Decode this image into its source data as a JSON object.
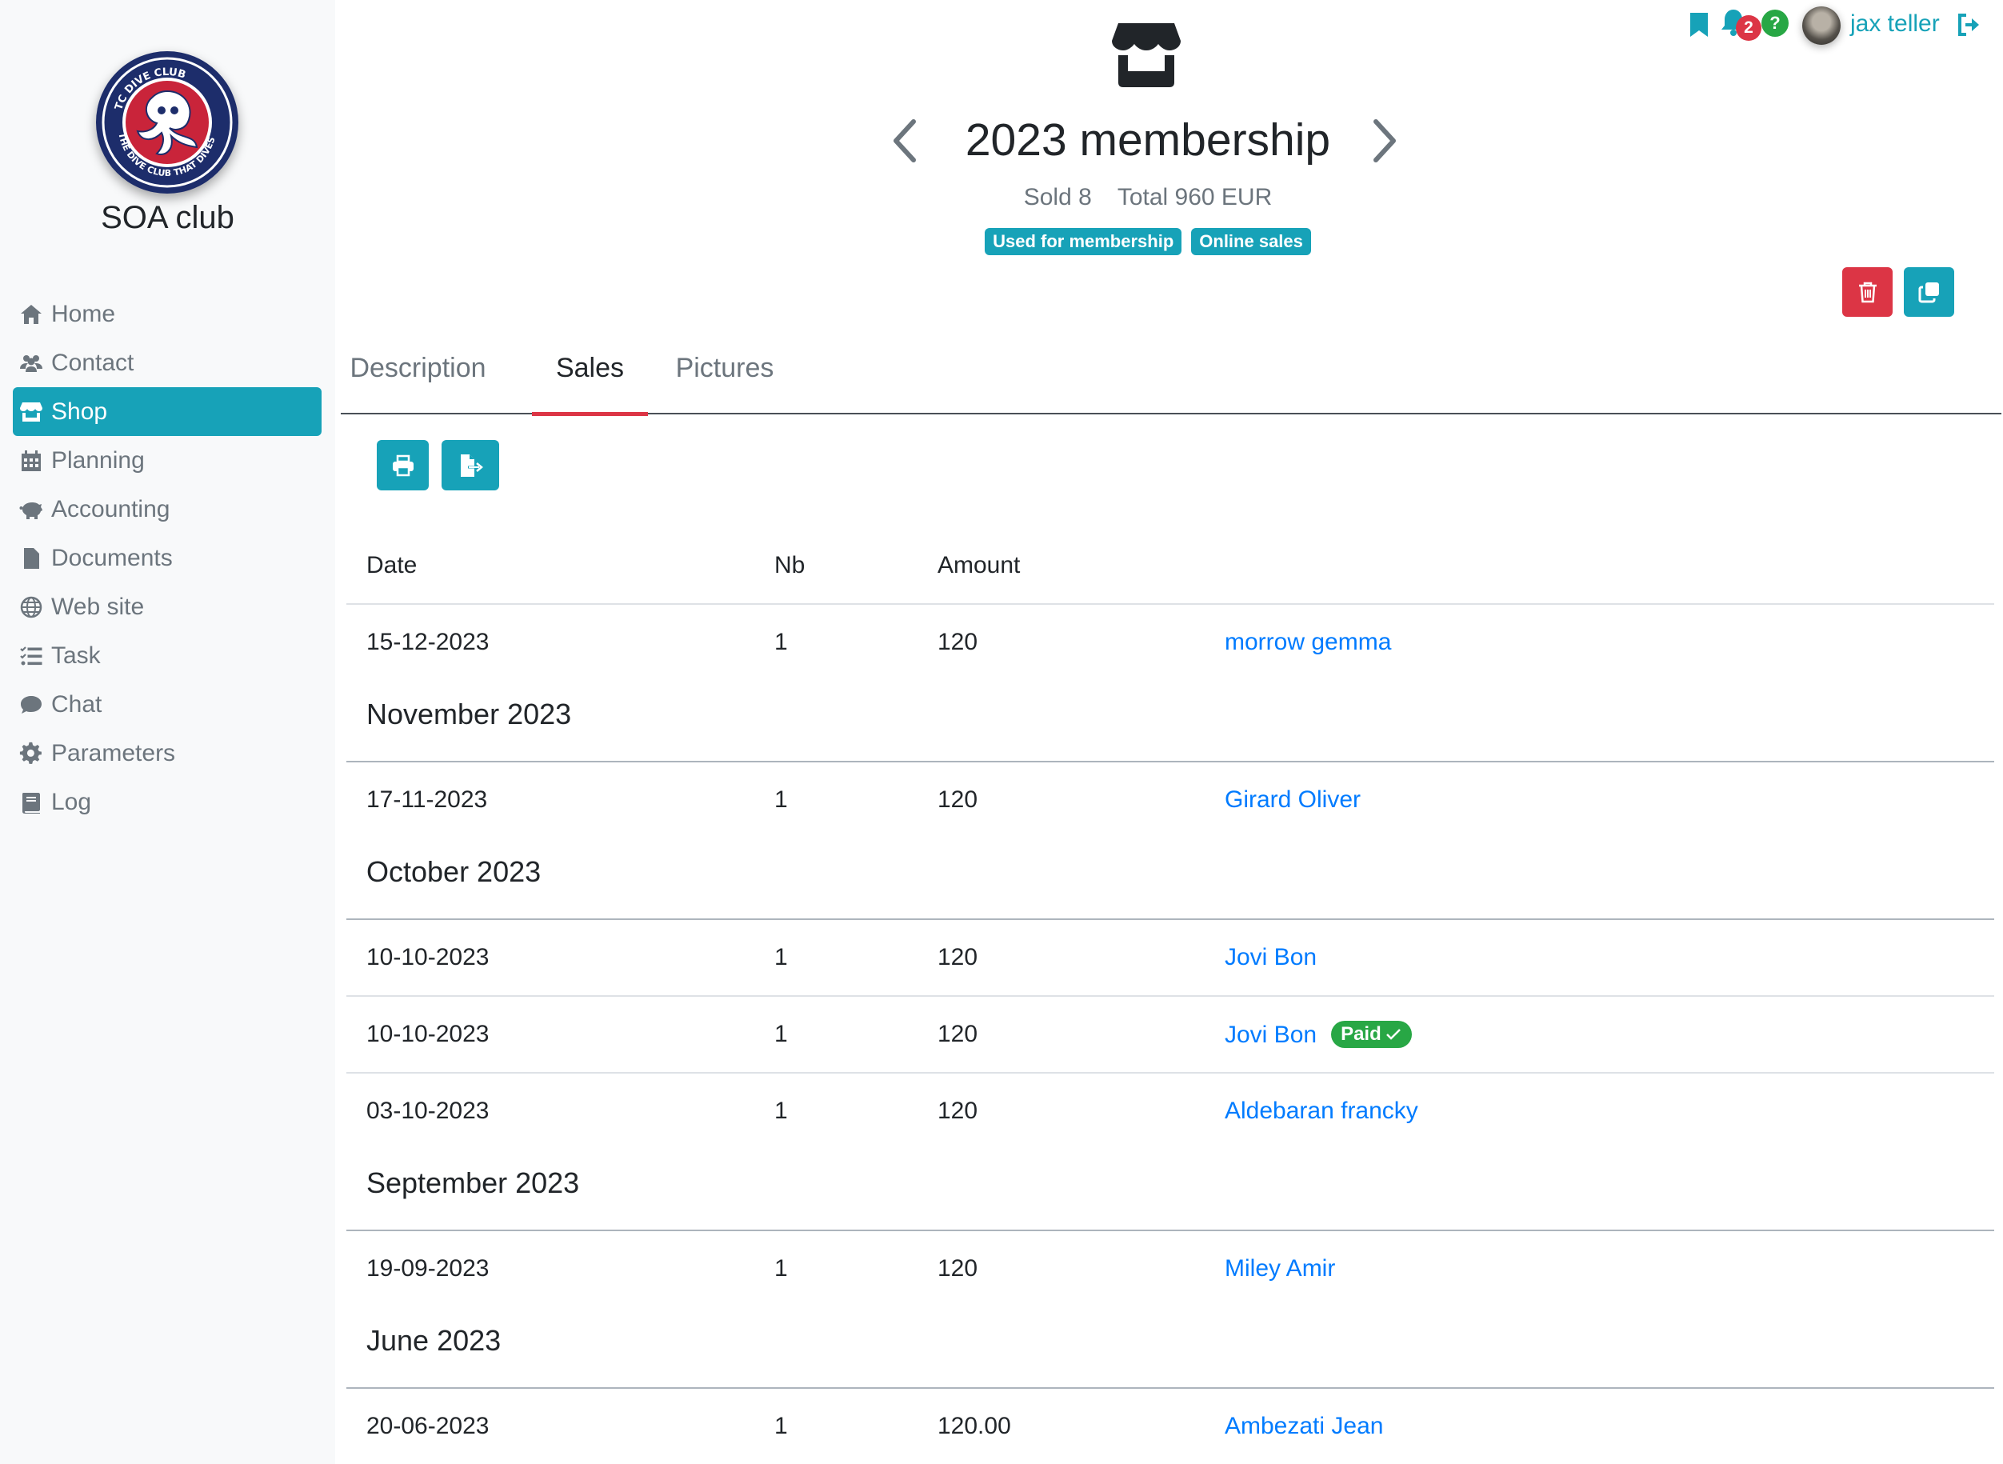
{
  "club": {
    "name": "SOA club",
    "logo_text": "TC DIVE CLUB · THE DIVE CLUB THAT DIVES"
  },
  "nav": [
    {
      "label": "Home",
      "icon": "home-icon",
      "active": false
    },
    {
      "label": "Contact",
      "icon": "users-icon",
      "active": false
    },
    {
      "label": "Shop",
      "icon": "store-icon",
      "active": true
    },
    {
      "label": "Planning",
      "icon": "calendar-icon",
      "active": false
    },
    {
      "label": "Accounting",
      "icon": "piggy-bank-icon",
      "active": false
    },
    {
      "label": "Documents",
      "icon": "file-icon",
      "active": false
    },
    {
      "label": "Web site",
      "icon": "globe-icon",
      "active": false
    },
    {
      "label": "Task",
      "icon": "task-list-icon",
      "active": false
    },
    {
      "label": "Chat",
      "icon": "chat-icon",
      "active": false
    },
    {
      "label": "Parameters",
      "icon": "gear-icon",
      "active": false
    },
    {
      "label": "Log",
      "icon": "book-icon",
      "active": false
    }
  ],
  "userbar": {
    "notifications_count": "2",
    "help_badge": "?",
    "username": "jax teller"
  },
  "header": {
    "title": "2023 membership",
    "sold": "Sold 8",
    "total": "Total 960 EUR",
    "tags": [
      "Used for membership",
      "Online sales"
    ]
  },
  "tabs": [
    {
      "label": "Description",
      "active": false
    },
    {
      "label": "Sales",
      "active": true
    },
    {
      "label": "Pictures",
      "active": false
    }
  ],
  "table": {
    "headers": {
      "date": "Date",
      "nb": "Nb",
      "amount": "Amount"
    },
    "first_rows": [
      {
        "date": "15-12-2023",
        "nb": "1",
        "amount": "120",
        "name": "morrow gemma"
      }
    ],
    "groups": [
      {
        "title": "November 2023",
        "rows": [
          {
            "date": "17-11-2023",
            "nb": "1",
            "amount": "120",
            "name": "Girard Oliver"
          }
        ]
      },
      {
        "title": "October 2023",
        "rows": [
          {
            "date": "10-10-2023",
            "nb": "1",
            "amount": "120",
            "name": "Jovi Bon"
          },
          {
            "date": "10-10-2023",
            "nb": "1",
            "amount": "120",
            "name": "Jovi Bon",
            "badge": "Paid"
          },
          {
            "date": "03-10-2023",
            "nb": "1",
            "amount": "120",
            "name": "Aldebaran francky"
          }
        ]
      },
      {
        "title": "September 2023",
        "rows": [
          {
            "date": "19-09-2023",
            "nb": "1",
            "amount": "120",
            "name": "Miley Amir"
          }
        ]
      },
      {
        "title": "June 2023",
        "rows": [
          {
            "date": "20-06-2023",
            "nb": "1",
            "amount": "120.00",
            "name": "Ambezati Jean"
          }
        ]
      }
    ]
  },
  "colors": {
    "primary": "#17a2b8",
    "danger": "#dc3545",
    "success": "#28a745",
    "link": "#007bff"
  }
}
